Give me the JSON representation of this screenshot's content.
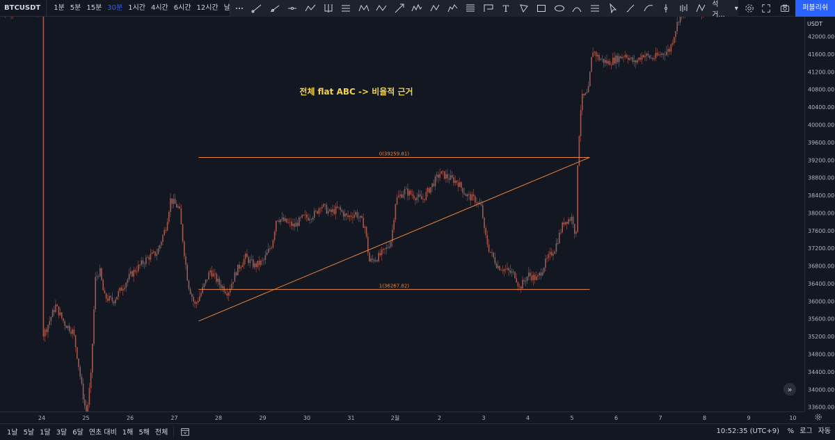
{
  "toolbar": {
    "symbol": "BTCUSDT",
    "intervals": [
      {
        "label": "1분",
        "active": false
      },
      {
        "label": "5분",
        "active": false
      },
      {
        "label": "15분",
        "active": false
      },
      {
        "label": "30분",
        "active": true
      },
      {
        "label": "1시간",
        "active": false
      },
      {
        "label": "4시간",
        "active": false
      },
      {
        "label": "6시간",
        "active": false
      },
      {
        "label": "12시간",
        "active": false
      },
      {
        "label": "날",
        "active": false
      }
    ],
    "drawing_tools": [
      "candles-icon",
      "cursor-dots-icon",
      "trend-line-icon",
      "ray-icon",
      "horizontal-ray-icon",
      "polyline-icon",
      "pitchfork-icon",
      "parallel-channel-icon",
      "xabcd-pattern-icon",
      "abcd-pattern-icon",
      "arrow-icon",
      "wave-icon",
      "abc-wave-icon",
      "elliott-wave-icon",
      "fib-channel-icon",
      "long-position-icon",
      "text-icon",
      "path-icon",
      "rectangle-icon",
      "ellipse-icon",
      "arc-icon",
      "measure-icon",
      "cursor-icon",
      "brush-icon",
      "curve-icon",
      "vertical-line-icon",
      "bar-pattern-icon",
      "anchored-icon"
    ],
    "more_label": "석 거...",
    "publish_label": "퍼블리쉬"
  },
  "chart": {
    "annotation": "전체 flat ABC -> 비율적 근거",
    "fib_top_label": "0(39259.81)",
    "fib_bottom_label": "1(36267.82)",
    "fib_top": 39259.81,
    "fib_bottom": 36267.82,
    "trendline": {
      "from": {
        "date": "27",
        "price": 35550
      },
      "to": {
        "date": "5",
        "price": 39259.81
      }
    },
    "colors": {
      "background": "#131722",
      "candles": "#a05a4f",
      "fib": "#e8843e",
      "annotation": "#f2d24b"
    },
    "currency": "USDT",
    "price_ticks": [
      "42000.00",
      "41600.00",
      "41200.00",
      "40800.00",
      "40400.00",
      "40000.00",
      "39600.00",
      "39200.00",
      "38800.00",
      "38400.00",
      "38000.00",
      "37600.00",
      "37200.00",
      "36800.00",
      "36400.00",
      "36000.00",
      "35600.00",
      "35200.00",
      "34800.00",
      "34400.00",
      "34000.00",
      "33600.00"
    ],
    "date_ticks": [
      "24",
      "25",
      "26",
      "27",
      "28",
      "29",
      "30",
      "31",
      "2월",
      "2",
      "3",
      "4",
      "5",
      "6",
      "7",
      "8",
      "9",
      "10"
    ]
  },
  "chart_data": {
    "type": "candlestick",
    "title": "",
    "ylim": [
      33500,
      42450
    ],
    "x_categories": [
      "24",
      "25",
      "26",
      "27",
      "28",
      "29",
      "30",
      "31",
      "2월",
      "2",
      "3",
      "4",
      "5",
      "6",
      "7",
      "8",
      "9",
      "10"
    ],
    "close_path": [
      [
        0.0,
        35200
      ],
      [
        0.1,
        35400
      ],
      [
        0.3,
        35900
      ],
      [
        0.5,
        35500
      ],
      [
        0.7,
        35300
      ],
      [
        0.8,
        34700
      ],
      [
        0.9,
        34000
      ],
      [
        1.0,
        33400
      ],
      [
        1.1,
        34300
      ],
      [
        1.2,
        36500
      ],
      [
        1.3,
        36700
      ],
      [
        1.4,
        36100
      ],
      [
        1.6,
        36000
      ],
      [
        1.8,
        36300
      ],
      [
        2.0,
        36600
      ],
      [
        2.2,
        36800
      ],
      [
        2.4,
        37000
      ],
      [
        2.6,
        37100
      ],
      [
        2.8,
        37700
      ],
      [
        2.9,
        38300
      ],
      [
        3.1,
        38100
      ],
      [
        3.2,
        37200
      ],
      [
        3.3,
        36400
      ],
      [
        3.45,
        35900
      ],
      [
        3.6,
        36200
      ],
      [
        3.8,
        36700
      ],
      [
        4.0,
        36400
      ],
      [
        4.2,
        36200
      ],
      [
        4.4,
        36700
      ],
      [
        4.6,
        37000
      ],
      [
        4.8,
        36800
      ],
      [
        5.0,
        36900
      ],
      [
        5.2,
        37300
      ],
      [
        5.3,
        37900
      ],
      [
        5.5,
        37800
      ],
      [
        5.7,
        37700
      ],
      [
        5.9,
        37900
      ],
      [
        6.0,
        37900
      ],
      [
        6.2,
        38000
      ],
      [
        6.3,
        38200
      ],
      [
        6.5,
        38000
      ],
      [
        6.7,
        38100
      ],
      [
        6.9,
        37900
      ],
      [
        7.1,
        38000
      ],
      [
        7.3,
        37700
      ],
      [
        7.4,
        36900
      ],
      [
        7.6,
        37000
      ],
      [
        7.8,
        37200
      ],
      [
        7.9,
        37400
      ],
      [
        8.0,
        38300
      ],
      [
        8.2,
        38500
      ],
      [
        8.4,
        38400
      ],
      [
        8.6,
        38300
      ],
      [
        8.8,
        38600
      ],
      [
        9.0,
        38900
      ],
      [
        9.2,
        38800
      ],
      [
        9.4,
        38700
      ],
      [
        9.6,
        38400
      ],
      [
        9.8,
        38300
      ],
      [
        9.95,
        38100
      ],
      [
        10.0,
        37600
      ],
      [
        10.1,
        37200
      ],
      [
        10.3,
        36800
      ],
      [
        10.5,
        36700
      ],
      [
        10.7,
        36600
      ],
      [
        10.8,
        36300
      ],
      [
        11.0,
        36600
      ],
      [
        11.2,
        36500
      ],
      [
        11.4,
        36900
      ],
      [
        11.6,
        37200
      ],
      [
        11.8,
        37800
      ],
      [
        12.0,
        37900
      ],
      [
        12.08,
        37400
      ],
      [
        12.12,
        39300
      ],
      [
        12.2,
        40600
      ],
      [
        12.35,
        40700
      ],
      [
        12.45,
        41700
      ],
      [
        12.6,
        41500
      ],
      [
        12.8,
        41400
      ],
      [
        13.0,
        41500
      ],
      [
        13.2,
        41600
      ],
      [
        13.4,
        41400
      ],
      [
        13.6,
        41600
      ],
      [
        13.8,
        41500
      ],
      [
        14.0,
        41600
      ],
      [
        14.2,
        41700
      ],
      [
        14.4,
        42400
      ],
      [
        14.6,
        42700
      ],
      [
        14.8,
        42600
      ]
    ]
  }
}
